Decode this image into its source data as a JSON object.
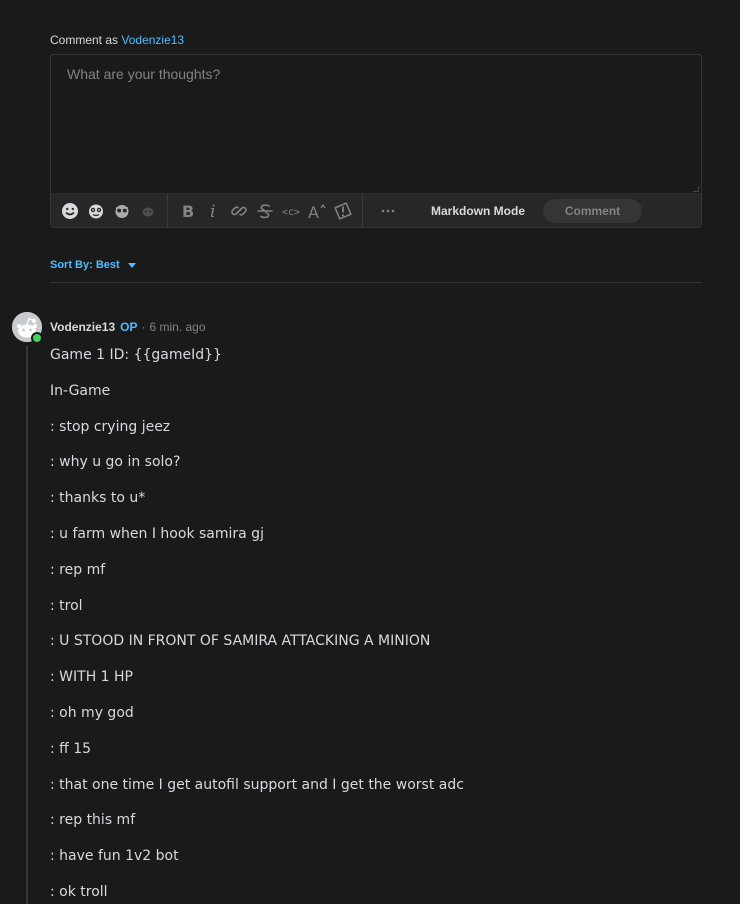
{
  "composer": {
    "comment_as_prefix": "Comment as",
    "username": "Vodenzie13",
    "placeholder": "What are your thoughts?",
    "markdown_mode_label": "Markdown Mode",
    "comment_button_label": "Comment",
    "toolbar_icons": [
      "smiley-icon",
      "emoji-icon",
      "emoji-icon",
      "emoji-icon",
      "bold-icon",
      "italic-icon",
      "link-icon",
      "strikethrough-icon",
      "inline-code-icon",
      "superscript-icon",
      "spoiler-icon",
      "more-icon"
    ]
  },
  "sort": {
    "label": "Sort By: Best"
  },
  "comment": {
    "author": "Vodenzie13",
    "op_badge": "OP",
    "separator": "·",
    "time": "6 min. ago",
    "lines": [
      "Game 1 ID: {{gameId}}",
      "In-Game",
      ": stop crying jeez",
      ": why u go in solo?",
      ": thanks to u*",
      ": u farm when I hook samira gj",
      ": rep mf",
      ": trol",
      ": U STOOD IN FRONT OF SAMIRA ATTACKING A MINION",
      ": WITH 1 HP",
      ": oh my god",
      ": ff 15",
      ": that one time I get autofil support and I get the worst adc",
      ": rep this mf",
      ": have fun 1v2 bot",
      ": ok troll"
    ]
  },
  "colors": {
    "background": "#1a1a1b",
    "accent_blue": "#4fbcff",
    "online_green": "#46d160",
    "muted_text": "#818384"
  }
}
